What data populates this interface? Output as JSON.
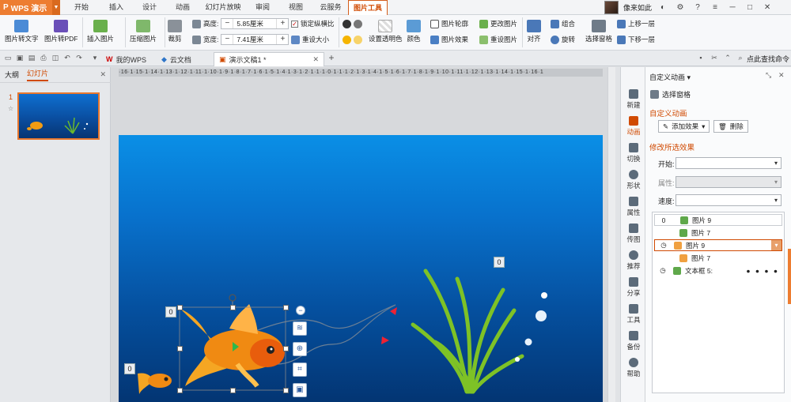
{
  "app": {
    "name": "WPS 演示",
    "logo": "P"
  },
  "menu": {
    "tabs": [
      "开始",
      "插入",
      "设计",
      "动画",
      "幻灯片放映",
      "审阅",
      "视图",
      "云服务",
      "图片工具"
    ],
    "active": "图片工具"
  },
  "user": {
    "name": "像来如此"
  },
  "ribbon": {
    "pic_to_text": "图片转文字",
    "pic_to_pdf": "图片转PDF",
    "insert_pic": "插入图片",
    "compress_pic": "压缩图片",
    "crop": "裁剪",
    "height_label": "高度:",
    "height_value": "5.85厘米",
    "width_label": "宽度:",
    "width_value": "7.41厘米",
    "lock_ratio": "锁定纵横比",
    "reset_size": "重设大小",
    "set_transparent": "设置透明色",
    "color": "颜色",
    "pic_outline": "图片轮廓",
    "pic_effect": "图片效果",
    "change_pic": "更改图片",
    "reset_pic": "重设图片",
    "align": "对齐",
    "group": "组合",
    "rotate": "旋转",
    "selection_pane": "选择窗格",
    "bring_forward": "上移一层",
    "send_backward": "下移一层"
  },
  "tabbar": {
    "tabs": [
      {
        "label": "我的WPS"
      },
      {
        "label": "云文档"
      },
      {
        "label": "演示文稿1 *"
      }
    ],
    "search": "点此查找命令"
  },
  "leftpane": {
    "tabs": [
      "大纲",
      "幻灯片"
    ],
    "active": "幻灯片",
    "slide_number": "1"
  },
  "slide": {
    "badges": [
      "0",
      "0",
      "0"
    ]
  },
  "strip": {
    "items": [
      "新建",
      "动画",
      "切换",
      "形状",
      "属性",
      "传图",
      "推荐",
      "分享",
      "工具",
      "备份",
      "帮助"
    ],
    "active": "动画"
  },
  "panel": {
    "header": "自定义动画",
    "select_pane": "选择窗格",
    "section_title": "自定义动画",
    "add_effect": "添加效果",
    "delete": "删除",
    "modify_title": "修改所选效果",
    "start_label": "开始:",
    "prop_label": "属性:",
    "speed_label": "速度:",
    "effects": [
      {
        "num": "0",
        "label": "图片 9"
      },
      {
        "num": "",
        "label": "图片 7"
      },
      {
        "num": "",
        "label": "图片 9"
      },
      {
        "num": "",
        "label": "图片 7"
      },
      {
        "num": "",
        "label": "文本框 5:",
        "extra": "● ● ● ●"
      }
    ]
  }
}
